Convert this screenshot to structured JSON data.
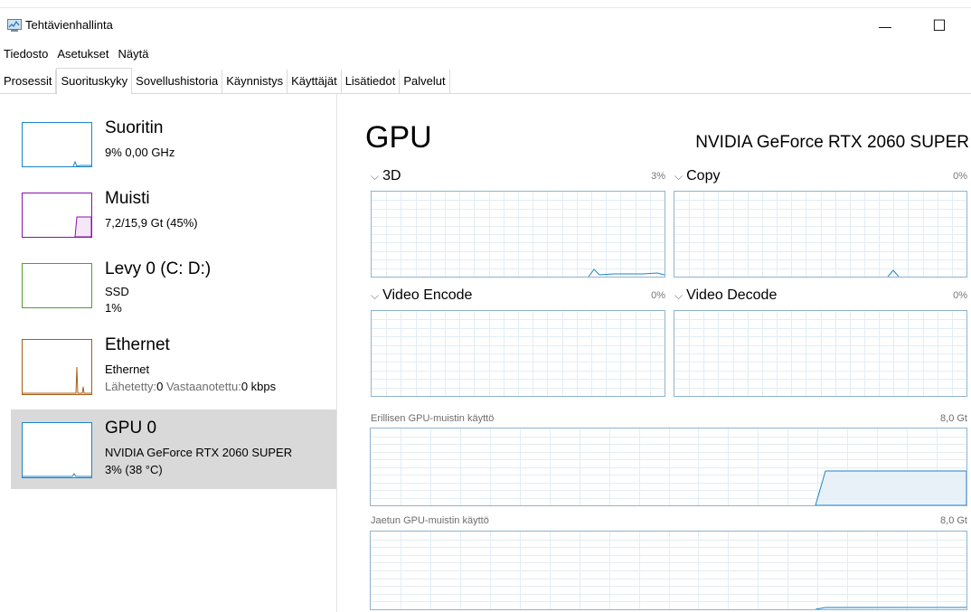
{
  "window": {
    "title": "Tehtävienhallinta",
    "minimize_glyph": "—",
    "maximize_glyph": "☐"
  },
  "menu": [
    "Tiedosto",
    "Asetukset",
    "Näytä"
  ],
  "tabs": [
    {
      "label": "Prosessit",
      "active": false
    },
    {
      "label": "Suorituskyky",
      "active": true
    },
    {
      "label": "Sovellushistoria",
      "active": false
    },
    {
      "label": "Käynnistys",
      "active": false
    },
    {
      "label": "Käyttäjät",
      "active": false
    },
    {
      "label": "Lisätiedot",
      "active": false
    },
    {
      "label": "Palvelut",
      "active": false
    }
  ],
  "sidebar": {
    "items": [
      {
        "name": "Suoritin",
        "line1": "9% 0,00 GHz",
        "line2": "",
        "line3": ""
      },
      {
        "name": "Muisti",
        "line1": "7,2/15,9 Gt (45%)",
        "line2": "",
        "line3": ""
      },
      {
        "name": "Levy 0 (C: D:)",
        "line1": "SSD",
        "line2": "1%",
        "line3": ""
      },
      {
        "name": "Ethernet",
        "line1": "Ethernet",
        "line2_a": "Lähetetty:",
        "line2_b": "0",
        "line2_c": " Vastaanotettu:",
        "line2_d": "0 kbps"
      },
      {
        "name": "GPU 0",
        "line1": "NVIDIA GeForce RTX 2060 SUPER",
        "line2": "3% (38 °C)",
        "line3": ""
      }
    ]
  },
  "main": {
    "heading": "GPU",
    "model": "NVIDIA GeForce RTX 2060 SUPER",
    "engines": [
      {
        "label": "3D",
        "percent": "3%"
      },
      {
        "label": "Copy",
        "percent": "0%"
      },
      {
        "label": "Video Encode",
        "percent": "0%"
      },
      {
        "label": "Video Decode",
        "percent": "0%"
      }
    ],
    "dedicated_memory": {
      "label": "Erillisen GPU-muistin käyttö",
      "max": "8,0 Gt"
    },
    "shared_memory": {
      "label": "Jaetun GPU-muistin käyttö",
      "max": "8,0 Gt"
    }
  },
  "colors": {
    "cpu": "#1c85c8",
    "memory": "#8b12ae",
    "disk": "#4ca22c",
    "ethernet": "#a75f18",
    "gpu": "#1c85c8",
    "graph_border": "#8fb3cf",
    "grid": "#e3edf5"
  }
}
